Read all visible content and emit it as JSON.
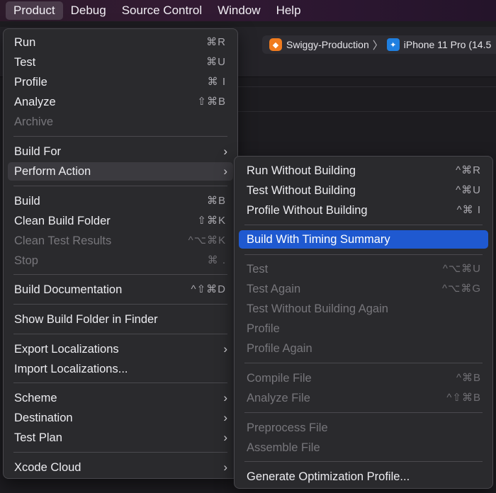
{
  "menubar": {
    "items": [
      "Product",
      "Debug",
      "Source Control",
      "Window",
      "Help"
    ]
  },
  "toolbar": {
    "scheme": "Swiggy-Production",
    "device": "iPhone 11 Pro (14.5"
  },
  "product_menu": {
    "items": [
      {
        "label": "Run",
        "shortcut": "⌘R"
      },
      {
        "label": "Test",
        "shortcut": "⌘U"
      },
      {
        "label": "Profile",
        "shortcut": "⌘ I"
      },
      {
        "label": "Analyze",
        "shortcut": "⇧⌘B"
      },
      {
        "label": "Archive",
        "shortcut": ""
      },
      {
        "label": "Build For",
        "shortcut": ""
      },
      {
        "label": "Perform Action",
        "shortcut": ""
      },
      {
        "label": "Build",
        "shortcut": "⌘B"
      },
      {
        "label": "Clean Build Folder",
        "shortcut": "⇧⌘K"
      },
      {
        "label": "Clean Test Results",
        "shortcut": "^⌥⌘K"
      },
      {
        "label": "Stop",
        "shortcut": "⌘ ."
      },
      {
        "label": "Build Documentation",
        "shortcut": "^⇧⌘D"
      },
      {
        "label": "Show Build Folder in Finder",
        "shortcut": ""
      },
      {
        "label": "Export Localizations",
        "shortcut": ""
      },
      {
        "label": "Import Localizations...",
        "shortcut": ""
      },
      {
        "label": "Scheme",
        "shortcut": ""
      },
      {
        "label": "Destination",
        "shortcut": ""
      },
      {
        "label": "Test Plan",
        "shortcut": ""
      },
      {
        "label": "Xcode Cloud",
        "shortcut": ""
      }
    ]
  },
  "perform_action_menu": {
    "items": [
      {
        "label": "Run Without Building",
        "shortcut": "^⌘R"
      },
      {
        "label": "Test Without Building",
        "shortcut": "^⌘U"
      },
      {
        "label": "Profile Without Building",
        "shortcut": "^⌘ I"
      },
      {
        "label": "Build With Timing Summary",
        "shortcut": ""
      },
      {
        "label": "Test",
        "shortcut": "^⌥⌘U"
      },
      {
        "label": "Test Again",
        "shortcut": "^⌥⌘G"
      },
      {
        "label": "Test Without Building Again",
        "shortcut": ""
      },
      {
        "label": "Profile",
        "shortcut": ""
      },
      {
        "label": "Profile Again",
        "shortcut": ""
      },
      {
        "label": "Compile File",
        "shortcut": "^⌘B"
      },
      {
        "label": "Analyze File",
        "shortcut": "^⇧⌘B"
      },
      {
        "label": "Preprocess File",
        "shortcut": ""
      },
      {
        "label": "Assemble File",
        "shortcut": ""
      },
      {
        "label": "Generate Optimization Profile...",
        "shortcut": ""
      }
    ]
  },
  "colors": {
    "selection": "#1f59d0",
    "menu_bg": "#2a2a2d",
    "disabled_text": "#77767b"
  },
  "icons": {
    "submenu": "chevron-right-icon",
    "scheme_app": "swiggy-app-icon",
    "device": "xcode-device-icon"
  }
}
